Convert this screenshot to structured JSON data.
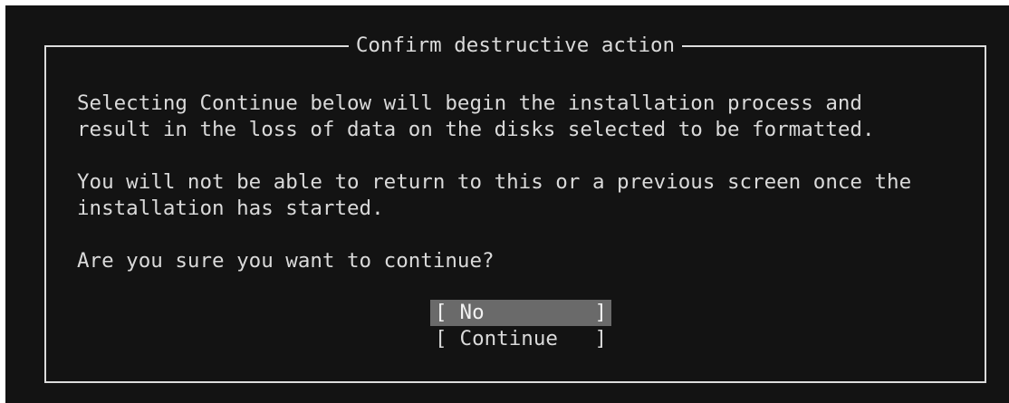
{
  "dialog": {
    "title": "Confirm destructive action",
    "paragraphs": [
      {
        "line1": "Selecting Continue below will begin the installation process and",
        "line2": "result in the loss of data on the disks selected to be formatted."
      },
      {
        "line1": "You will not be able to return to this or a previous screen once the",
        "line2": "installation has started."
      },
      {
        "line1": "Are you sure you want to continue?"
      }
    ],
    "buttons": [
      {
        "open": "[",
        "label": "No",
        "close": "]",
        "selected": true
      },
      {
        "open": "[",
        "label": "Continue",
        "close": "]",
        "selected": false
      }
    ]
  },
  "colors": {
    "background": "#131313",
    "text": "#dadada",
    "border": "#dcdcdc",
    "selected_button_bg": "#6a6a6a"
  }
}
